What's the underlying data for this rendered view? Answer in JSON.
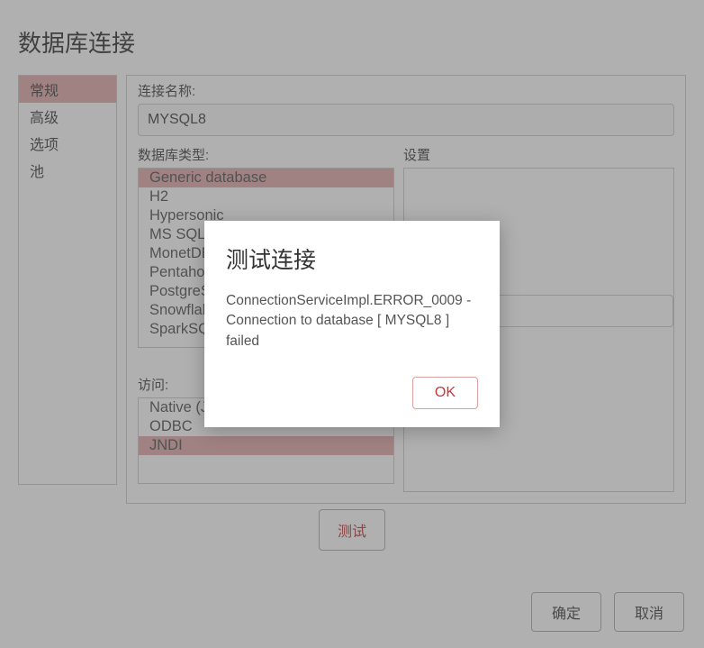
{
  "dialog": {
    "title": "数据库连接"
  },
  "tabs": {
    "items": [
      {
        "label": "常规",
        "active": true
      },
      {
        "label": "高级",
        "active": false
      },
      {
        "label": "选项",
        "active": false
      },
      {
        "label": "池",
        "active": false
      }
    ]
  },
  "conn_name": {
    "label": "连接名称:",
    "value": "MYSQL8"
  },
  "db_type": {
    "label": "数据库类型:",
    "items": [
      {
        "label": "Generic database",
        "selected": true
      },
      {
        "label": "H2",
        "selected": false
      },
      {
        "label": "Hypersonic",
        "selected": false
      },
      {
        "label": "MS SQL Server",
        "selected": false
      },
      {
        "label": "MonetDB",
        "selected": false
      },
      {
        "label": "Pentaho Data Services",
        "selected": false
      },
      {
        "label": "PostgreSQL",
        "selected": false
      },
      {
        "label": "Snowflake",
        "selected": false
      },
      {
        "label": "SparkSQL",
        "selected": false
      }
    ]
  },
  "settings": {
    "label": "设置"
  },
  "access": {
    "label": "访问:",
    "items": [
      {
        "label": "Native (JDBC)",
        "selected": false
      },
      {
        "label": "ODBC",
        "selected": false
      },
      {
        "label": "JNDI",
        "selected": true
      }
    ]
  },
  "buttons": {
    "test": "测试",
    "ok": "确定",
    "cancel": "取消"
  },
  "modal": {
    "title": "测试连接",
    "body": "ConnectionServiceImpl.ERROR_0009 - Connection to database [ MYSQL8 ] failed",
    "ok": "OK"
  }
}
